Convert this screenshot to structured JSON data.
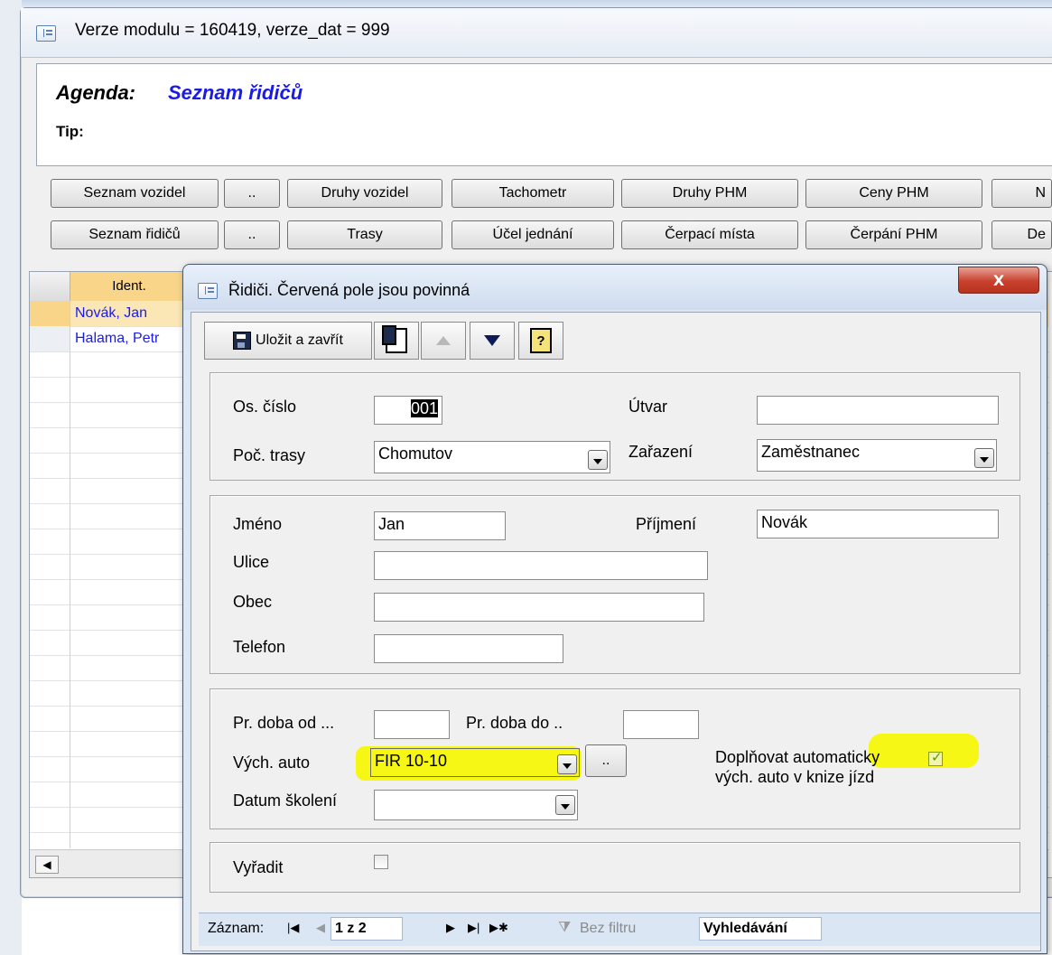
{
  "outer": {
    "title": "Verze modulu = 160419, verze_dat = 999",
    "agenda_label": "Agenda:",
    "agenda_value": "Seznam řidičů",
    "tip_label": "Tip:",
    "buttons_row1": [
      "Seznam vozidel",
      "..",
      "Druhy vozidel",
      "Tachometr",
      "Druhy PHM",
      "Ceny PHM",
      "N"
    ],
    "buttons_row2": [
      "Seznam řidičů",
      "..",
      "Trasy",
      "Účel jednání",
      "Čerpací místa",
      "Čerpání PHM",
      "De"
    ]
  },
  "list": {
    "header": "Ident.",
    "rows": [
      "Novák, Jan",
      "Halama, Petr"
    ]
  },
  "dialog": {
    "title": "Řidiči. Červená pole jsou povinná",
    "close_label": "X",
    "toolbar": {
      "save_label": "Uložit a zavřít"
    },
    "os_cislo_label": "Os. číslo",
    "os_cislo_value": "001",
    "utvar_label": "Útvar",
    "utvar_value": "",
    "poc_trasy_label": "Poč. trasy",
    "poc_trasy_value": "Chomutov",
    "zarazeni_label": "Zařazení",
    "zarazeni_value": "Zaměstnanec",
    "jmeno_label": "Jméno",
    "jmeno_value": "Jan",
    "prijmeni_label": "Příjmení",
    "prijmeni_value": "Novák",
    "ulice_label": "Ulice",
    "obec_label": "Obec",
    "telefon_label": "Telefon",
    "pr_od_label": "Pr. doba od ...",
    "pr_do_label": "Pr. doba do ..",
    "vych_auto_label": "Vých. auto",
    "vych_auto_value": "FIR 10-10",
    "ellipsis_label": "..",
    "doplnovat_line1": "Doplňovat automaticky",
    "doplnovat_line2": "vých. auto v knize jízd",
    "datum_skoleni_label": "Datum školení",
    "vyradit_label": "Vyřadit",
    "highlight_color": "#f7f716"
  },
  "statusbar": {
    "zaznam_label": "Záznam:",
    "record_pos": "1 z 2",
    "filter_label": "Bez filtru",
    "search_label": "Vyhledávání"
  }
}
